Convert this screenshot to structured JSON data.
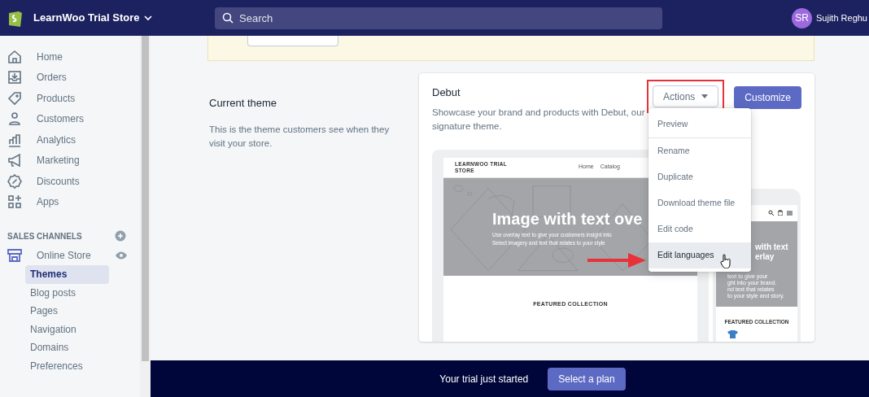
{
  "topbar": {
    "store": "LearnWoo Trial Store",
    "search": {
      "placeholder": "Search"
    },
    "user": {
      "initials": "SR",
      "name": "Sujith Reghu"
    }
  },
  "sidebar": {
    "items": [
      {
        "label": "Home"
      },
      {
        "label": "Orders"
      },
      {
        "label": "Products"
      },
      {
        "label": "Customers"
      },
      {
        "label": "Analytics"
      },
      {
        "label": "Marketing"
      },
      {
        "label": "Discounts"
      },
      {
        "label": "Apps"
      }
    ],
    "channels_heading": "SALES CHANNELS",
    "channel": "Online Store",
    "subitems": [
      {
        "label": "Themes",
        "selected": true
      },
      {
        "label": "Blog posts",
        "selected": false
      },
      {
        "label": "Pages",
        "selected": false
      },
      {
        "label": "Navigation",
        "selected": false
      },
      {
        "label": "Domains",
        "selected": false
      },
      {
        "label": "Preferences",
        "selected": false
      }
    ]
  },
  "section": {
    "title": "Current theme",
    "description": "This is the theme customers see when they visit your store."
  },
  "card": {
    "theme": "Debut",
    "description": "Showcase your brand and products with Debut, our signature theme.",
    "actions": "Actions",
    "customize": "Customize",
    "menu": [
      {
        "label": "Preview",
        "hovered": false
      },
      {
        "label": "Rename",
        "hovered": false
      },
      {
        "label": "Duplicate",
        "hovered": false
      },
      {
        "label": "Download theme file",
        "hovered": false
      },
      {
        "label": "Edit code",
        "hovered": false
      },
      {
        "label": "Edit languages",
        "hovered": true
      }
    ],
    "preview": {
      "store": "LEARNWOO TRIAL STORE",
      "nav": [
        "Home",
        "Catalog"
      ],
      "headline": "Image with text ove",
      "lines": [
        "Use overlay text to give your customers insight into",
        "Select imagery and text that relates to your style"
      ],
      "featured": "FEATURED COLLECTION",
      "mobile": {
        "headline": [
          "with text",
          "erlay"
        ],
        "lines": [
          "text to give your",
          "ght into your brand.",
          "nd text that relates",
          "to your style and story."
        ],
        "featured": "FEATURED COLLECTION"
      }
    }
  },
  "trial": {
    "text": "Your trial just started",
    "button": "Select a plan"
  }
}
